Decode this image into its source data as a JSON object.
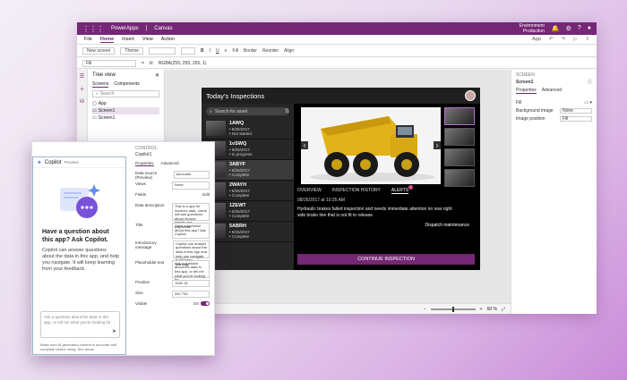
{
  "titlebar": {
    "app": "PowerApps",
    "separator": "|",
    "doc": "Canvas",
    "env_label": "Environment",
    "env_value": "Production"
  },
  "menu": {
    "items": [
      "File",
      "Home",
      "Insert",
      "View",
      "Action"
    ],
    "active": "Home",
    "app_label": "App"
  },
  "ribbon": {
    "new_screen": "New screen",
    "theme": "Theme",
    "bold": "B",
    "italic": "I",
    "underline": "U",
    "fill": "Fill",
    "border": "Border",
    "reorder": "Reorder",
    "align": "Align"
  },
  "formula": {
    "property": "Fill",
    "fx": "fx",
    "equals": "=",
    "value": "RGBA(255, 255, 255, 1)"
  },
  "tree": {
    "title": "Tree view",
    "tabs": [
      "Screens",
      "Components"
    ],
    "search_placeholder": "Search",
    "nodes": [
      "App",
      "Screen1",
      "Screen1"
    ]
  },
  "props": {
    "kind": "SCREEN",
    "name": "Screen1",
    "tabs": [
      "Properties",
      "Advanced"
    ],
    "rows": [
      {
        "label": "Fill",
        "value": ""
      },
      {
        "label": "Background image",
        "value": "None"
      },
      {
        "label": "Image position",
        "value": "Fill"
      }
    ]
  },
  "status": {
    "zoom": "60 %"
  },
  "app": {
    "title": "Today's Inspections",
    "search_placeholder": "Search for asset",
    "items": [
      {
        "id": "1AWQ",
        "l1": "• 8/25/2017",
        "l2": "• Not started"
      },
      {
        "id": "1vSWQ",
        "l1": "• 8/25/2017",
        "l2": "• In progress"
      },
      {
        "id": "3ABYF",
        "l1": "• 8/25/2017",
        "l2": "• Complete"
      },
      {
        "id": "2WAYH",
        "l1": "• 8/25/2017",
        "l2": "• Complete"
      },
      {
        "id": "1ZEWT",
        "l1": "• 8/25/2017",
        "l2": "• Complete"
      },
      {
        "id": "5ABRH",
        "l1": "• 8/25/2017",
        "l2": "• Complete"
      }
    ],
    "tabs": [
      "OVERVIEW",
      "INSPECTION HISTORY",
      "ALERTS"
    ],
    "date": "08/25/2017 at 10:35 AM",
    "message": "Hydraulic brakes failed inspection and needs immediate attention on rear right side brake line that is not fit to release.",
    "dispatch": "Dispatch maintenance",
    "continue": "CONTINUE INSPECTION"
  },
  "copilot": {
    "title": "Copilot",
    "badge": "Preview",
    "heading": "Have a question about this app? Ask Copilot.",
    "description": "Copilot can answer questions about the data in this app, and help you navigate. It will keep learning from your feedback.",
    "input_placeholder": "Ask a question about the data in this app, or tell me what you're looking for",
    "disclaimer": "Make sure AI-generated content is accurate and complete before using. See terms"
  },
  "copilot_props": {
    "kind": "CONTROL",
    "name": "Copilot1",
    "tabs": [
      "Properties",
      "Advanced"
    ],
    "rows": [
      {
        "label": "Data source (Preview)",
        "value": "Accounts"
      },
      {
        "label": "Views",
        "value": "None"
      },
      {
        "label": "Fields",
        "value": "Edit"
      },
      {
        "label": "Data description",
        "value": "This is a app for invoices data. Users will ask questions about invoice details and payments."
      },
      {
        "label": "Title",
        "value": "Have a question about this app? Ask Copilot."
      },
      {
        "label": "Introductory message",
        "value": "Copilot can answer questions about the data in this app and help you navigate. It will keep learning."
      },
      {
        "label": "Placeholder text",
        "value": "Ask a question about the data in this app, or tell me what you're looking for"
      },
      {
        "label": "Position",
        "value": "1000   15"
      },
      {
        "label": "Size",
        "value": "340   753"
      },
      {
        "label": "Visible",
        "value": "On"
      }
    ]
  }
}
